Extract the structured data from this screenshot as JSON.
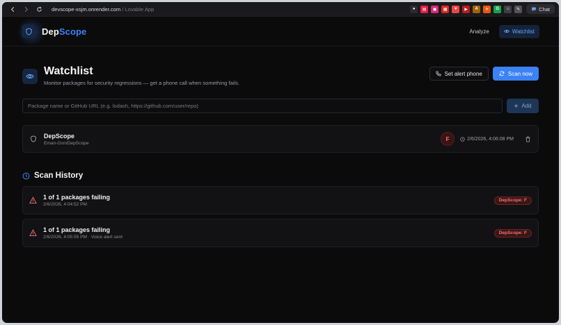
{
  "browser": {
    "url_domain": "devscope-xsjm.onrender.com",
    "url_separator": " / ",
    "url_site": "Lovable App",
    "chat_label": "Chat",
    "extensions": [
      {
        "name": "ext-dot-icon",
        "color": "#2b2b2e",
        "glyph": "●"
      },
      {
        "name": "ext-pdf-icon",
        "color": "#e11d48",
        "glyph": "▤"
      },
      {
        "name": "ext-square-icon",
        "color": "#db2777",
        "glyph": "◼"
      },
      {
        "name": "ext-grid-icon",
        "color": "#dc2626",
        "glyph": "▦"
      },
      {
        "name": "ext-heart-icon",
        "color": "#ef4444",
        "glyph": "♥"
      },
      {
        "name": "ext-play-icon",
        "color": "#b91c1c",
        "glyph": "▶"
      },
      {
        "name": "ext-a-icon",
        "color": "#a16207",
        "glyph": "A"
      },
      {
        "name": "ext-star-icon",
        "color": "#ea580c",
        "glyph": "✳"
      },
      {
        "name": "ext-g-icon",
        "color": "#16a34a",
        "glyph": "G"
      },
      {
        "name": "ext-home-icon",
        "color": "#3f3f46",
        "glyph": "⌂"
      },
      {
        "name": "ext-pen-icon",
        "color": "#52525b",
        "glyph": "✎"
      }
    ]
  },
  "header": {
    "brand_part1": "Dep",
    "brand_part2": "Scope",
    "nav_analyze": "Analyze",
    "nav_watchlist": "Watchlist"
  },
  "page": {
    "title": "Watchlist",
    "subtitle": "Monitor packages for security regressions — get a phone call when something fails.",
    "set_alert_label": "Set alert phone",
    "scan_now_label": "Scan now",
    "input_placeholder": "Package name or GitHub URL (e.g. lodash, https://github.com/user/repo)",
    "add_label": "Add"
  },
  "watchlist": [
    {
      "name": "DepScope",
      "repo": "Eman-Gon/DepScope",
      "grade": "F",
      "scanned_at": "2/6/2026, 4:06:08 PM"
    }
  ],
  "history": {
    "title": "Scan History",
    "entries": [
      {
        "title": "1 of 1 packages failing",
        "meta": "2/6/2026, 4:04:52 PM",
        "badge": "DepScope: F"
      },
      {
        "title": "1 of 1 packages failing",
        "meta": "2/6/2026, 4:05:55 PM · Voice alert sent",
        "badge": "DepScope: F"
      }
    ]
  },
  "colors": {
    "accent": "#3b82f6",
    "danger": "#f87171",
    "background": "#0b0b0c"
  }
}
